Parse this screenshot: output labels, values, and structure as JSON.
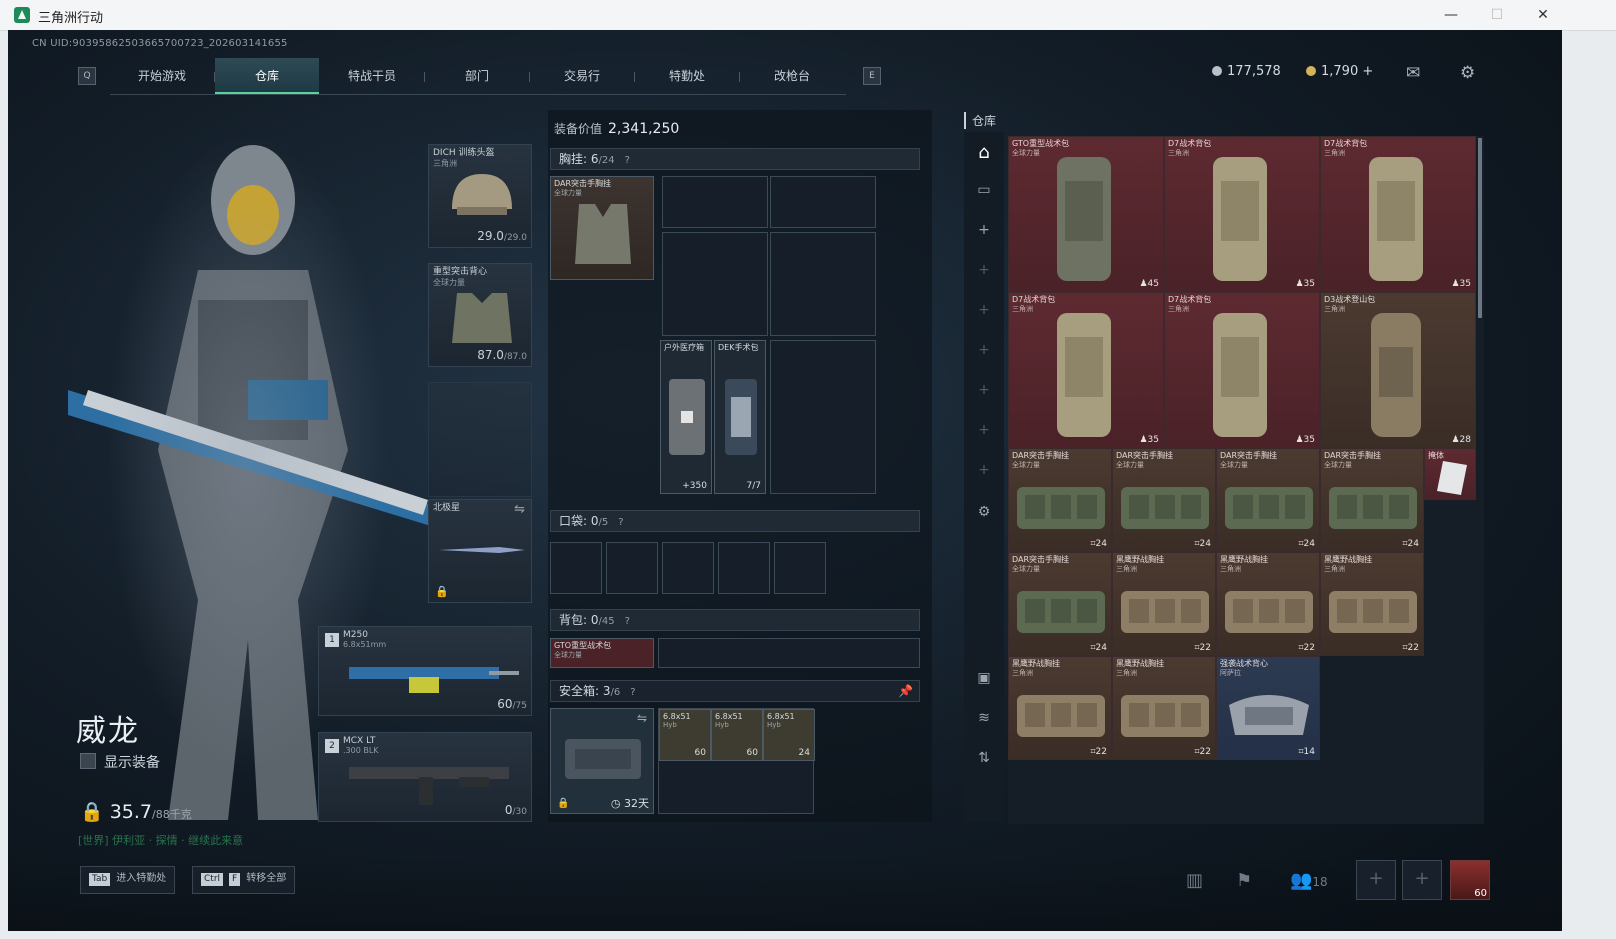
{
  "window": {
    "title": "三角洲行动",
    "min_label": "—",
    "max_label": "☐",
    "close_label": "✕"
  },
  "uid": "CN UID:9039586250366570072​3_202603141655",
  "nav": {
    "left_key": "Q",
    "right_key": "E",
    "tabs": [
      {
        "label": "开始游戏",
        "active": false
      },
      {
        "label": "仓库",
        "active": true
      },
      {
        "label": "特战干员",
        "active": false
      },
      {
        "label": "部门",
        "active": false
      },
      {
        "label": "交易行",
        "active": false
      },
      {
        "label": "特勤处",
        "active": false
      },
      {
        "label": "改枪台",
        "active": false
      }
    ]
  },
  "currency": {
    "silver": "177,578",
    "gold": "1,790",
    "gold_add": "+"
  },
  "operator": {
    "name": "威龙",
    "show_equipment": "显示装备",
    "weight": "35.7",
    "weight_max": "/88千克"
  },
  "chat": {
    "channel": "[世界]",
    "text": "伊利亚 · 探情 · 继续此来意"
  },
  "equipment": {
    "helmet": {
      "name": "DICH 训练头盔",
      "sub": "三角洲",
      "durability": "29.0",
      "max": "/29.0"
    },
    "armor": {
      "name": "重型突击背心",
      "sub": "全球力量",
      "durability": "87.0",
      "max": "/87.0"
    },
    "melee": {
      "name": "北极星"
    },
    "primary": {
      "slot": "1",
      "name": "M250",
      "caliber": "6.8x51mm",
      "ammo": "60",
      "max": "/75"
    },
    "secondary": {
      "slot": "2",
      "name": "MCX LT",
      "caliber": ".300 BLK",
      "ammo": "0",
      "max": "/30"
    }
  },
  "loadout": {
    "equip_value_label": "装备价值",
    "equip_value": "2,341,250",
    "chest": {
      "label": "胸挂:",
      "used": "6",
      "cap": "/24",
      "help": "?"
    },
    "chest_item": {
      "name": "DAR突击手胸挂",
      "sub": "全球力量"
    },
    "med1": {
      "name": "户外医疗箱",
      "count": "+350"
    },
    "med2": {
      "name": "DEK手术包",
      "count": "7/7"
    },
    "pocket": {
      "label": "口袋:",
      "used": "0",
      "cap": "/5",
      "help": "?"
    },
    "backpack": {
      "label": "背包:",
      "used": "0",
      "cap": "/45",
      "help": "?"
    },
    "backpack_item": {
      "name": "GTO重型战术包",
      "sub": "全球力量"
    },
    "safebox": {
      "label": "安全箱:",
      "used": "3",
      "cap": "/6",
      "help": "?",
      "timer": "32天"
    },
    "ammo": [
      {
        "name": "6.8x51",
        "sub": "Hyb",
        "count": "60"
      },
      {
        "name": "6.8x51",
        "sub": "Hyb",
        "count": "60"
      },
      {
        "name": "6.8x51",
        "sub": "Hyb",
        "count": "24"
      }
    ]
  },
  "storage": {
    "label": "仓库",
    "items": [
      {
        "name": "GTO重型战术包",
        "sub": "全球力量",
        "count": "45",
        "color": "red"
      },
      {
        "name": "D7战术背包",
        "sub": "三角洲",
        "count": "35",
        "color": "red"
      },
      {
        "name": "D7战术背包",
        "sub": "三角洲",
        "count": "35",
        "color": "red"
      },
      {
        "name": "D7战术背包",
        "sub": "三角洲",
        "count": "35",
        "color": "red"
      },
      {
        "name": "D7战术背包",
        "sub": "三角洲",
        "count": "35",
        "color": "red"
      },
      {
        "name": "D3战术登山包",
        "sub": "三角洲",
        "count": "28",
        "color": "brown"
      },
      {
        "name": "DAR突击手胸挂",
        "sub": "全球力量",
        "count": "24",
        "color": "brown"
      },
      {
        "name": "DAR突击手胸挂",
        "sub": "全球力量",
        "count": "24",
        "color": "brown"
      },
      {
        "name": "DAR突击手胸挂",
        "sub": "全球力量",
        "count": "24",
        "color": "brown"
      },
      {
        "name": "DAR突击手胸挂",
        "sub": "全球力量",
        "count": "24",
        "color": "brown"
      },
      {
        "name": "DAR突击手胸挂",
        "sub": "全球力量",
        "count": "24",
        "color": "brown"
      },
      {
        "name": "黑鹰野战胸挂",
        "sub": "三角洲",
        "count": "22",
        "color": "brown"
      },
      {
        "name": "黑鹰野战胸挂",
        "sub": "三角洲",
        "count": "22",
        "color": "brown"
      },
      {
        "name": "黑鹰野战胸挂",
        "sub": "三角洲",
        "count": "22",
        "color": "brown"
      },
      {
        "name": "黑鹰野战胸挂",
        "sub": "三角洲",
        "count": "22",
        "color": "brown"
      },
      {
        "name": "黑鹰野战胸挂",
        "sub": "三角洲",
        "count": "22",
        "color": "brown"
      },
      {
        "name": "强袭战术背心",
        "sub": "阿萨拉",
        "count": "14",
        "color": "blue"
      }
    ],
    "small_item": {
      "name": "掩体"
    }
  },
  "bottom": {
    "hint1_key": "Tab",
    "hint1_text": "进入特勤处",
    "hint2_key1": "Ctrl",
    "hint2_key2": "F",
    "hint2_text": "转移全部",
    "friends": "18",
    "level": "60"
  }
}
